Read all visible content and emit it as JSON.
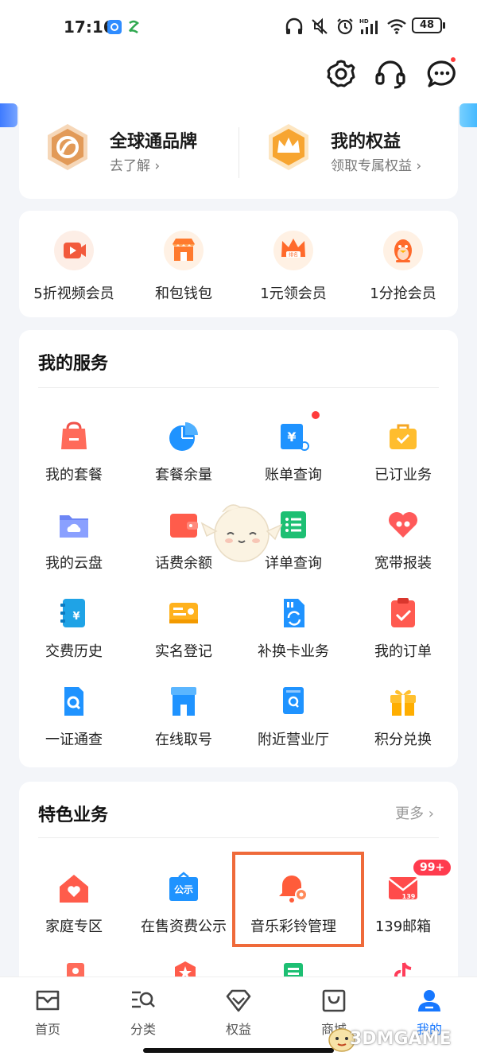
{
  "status_bar": {
    "time": "17:16",
    "battery": "48"
  },
  "header": {
    "settings_icon": "gear-icon",
    "service_icon": "headset-icon",
    "message_icon": "chat-icon"
  },
  "brand": [
    {
      "title": "全球通品牌",
      "sub": "去了解 ›",
      "icon": "globe-brand-icon"
    },
    {
      "title": "我的权益",
      "sub": "领取专属权益 ›",
      "icon": "crown-icon"
    }
  ],
  "promos": [
    {
      "label": "5折视频会员",
      "icon": "video-icon"
    },
    {
      "label": "和包钱包",
      "icon": "wallet-store-icon"
    },
    {
      "label": "1元领会员",
      "icon": "crown-rank-icon"
    },
    {
      "label": "1分抢会员",
      "icon": "penguin-icon"
    }
  ],
  "icon_text": {
    "rank": "排名",
    "public": "公示",
    "mail": "139",
    "yen": "¥"
  },
  "services": {
    "title": "我的服务",
    "items": [
      {
        "label": "我的套餐"
      },
      {
        "label": "套餐余量"
      },
      {
        "label": "账单查询"
      },
      {
        "label": "已订业务"
      },
      {
        "label": "我的云盘"
      },
      {
        "label": "话费余额"
      },
      {
        "label": "详单查询"
      },
      {
        "label": "宽带报装"
      },
      {
        "label": "交费历史"
      },
      {
        "label": "实名登记"
      },
      {
        "label": "补换卡业务"
      },
      {
        "label": "我的订单"
      },
      {
        "label": "一证通查"
      },
      {
        "label": "在线取号"
      },
      {
        "label": "附近营业厅"
      },
      {
        "label": "积分兑换"
      }
    ]
  },
  "features": {
    "title": "特色业务",
    "more": "更多 ›",
    "items": [
      {
        "label": "家庭专区"
      },
      {
        "label": "在售资费公示"
      },
      {
        "label": "音乐彩铃管理"
      },
      {
        "label": "139邮箱"
      }
    ],
    "mail_badge": "99+"
  },
  "tabs": [
    {
      "label": "首页"
    },
    {
      "label": "分类"
    },
    {
      "label": "权益"
    },
    {
      "label": "商城"
    },
    {
      "label": "我的"
    }
  ],
  "watermark": "3DMGAME",
  "colors": {
    "accent_blue": "#1677ff",
    "highlight": "#ef6a3a",
    "badge_red": "#ff3b4e"
  }
}
